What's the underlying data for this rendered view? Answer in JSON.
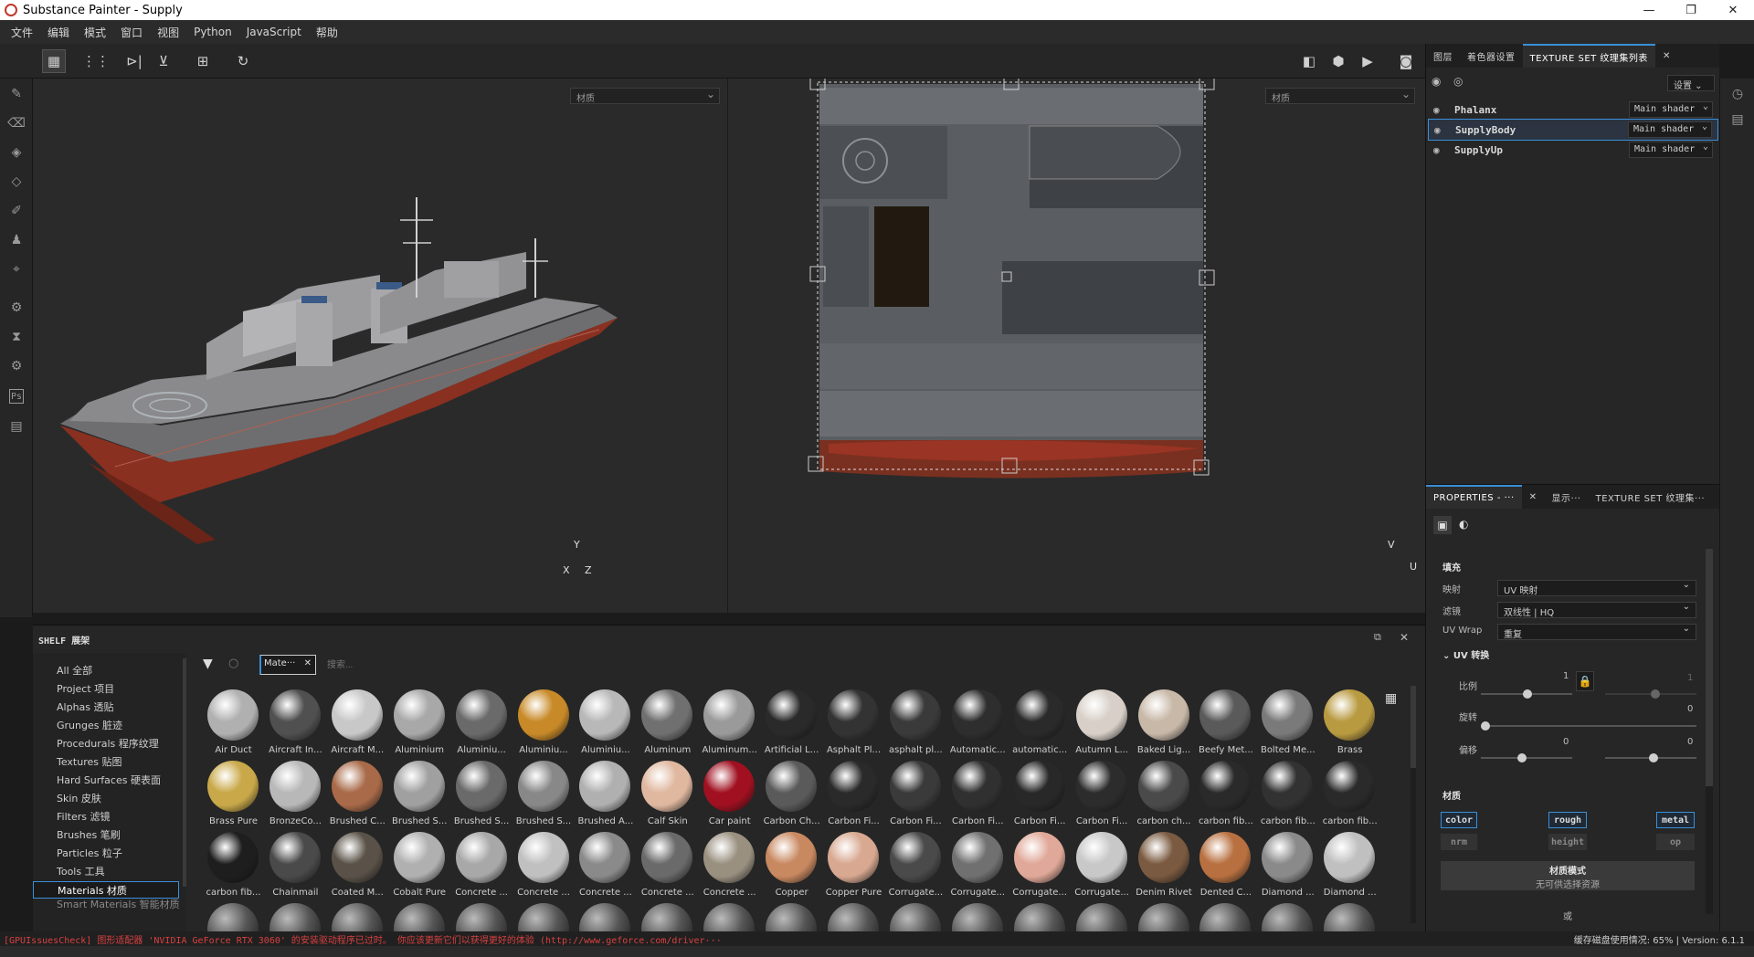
{
  "window": {
    "title": "Substance Painter - Supply",
    "controls": [
      "—",
      "❐",
      "✕"
    ]
  },
  "menu": [
    "文件",
    "编辑",
    "模式",
    "窗口",
    "视图",
    "Python",
    "JavaScript",
    "帮助"
  ],
  "viewports": {
    "left_material": "材质",
    "right_material": "材质",
    "axis3d": {
      "y": "Y",
      "x": "X",
      "z": "Z"
    },
    "axis2d": {
      "v": "V",
      "u": "U"
    }
  },
  "texture_set_panel": {
    "tabs": [
      "图层",
      "着色器设置",
      "TEXTURE SET 纹理集列表"
    ],
    "settings_label": "设置",
    "sets": [
      {
        "name": "Phalanx",
        "shader": "Main shader",
        "selected": false
      },
      {
        "name": "SupplyBody",
        "shader": "Main shader",
        "selected": true
      },
      {
        "name": "SupplyUp",
        "shader": "Main shader",
        "selected": false
      }
    ]
  },
  "properties": {
    "tabs": [
      "PROPERTIES - ···",
      "显示···",
      "TEXTURE SET 纹理集···"
    ],
    "fill_heading": "填充",
    "mapping_label": "映射",
    "mapping_value": "UV 映射",
    "filter_label": "滤镜",
    "filter_value": "双线性 | HQ",
    "uvwrap_label": "UV Wrap",
    "uvwrap_value": "重复",
    "uv_transform": "UV 转换",
    "scale_label": "比例",
    "scale_value": "1",
    "scale_value2": "1",
    "rotate_label": "旋转",
    "rotate_value": "0",
    "offset_label": "偏移",
    "offset_value1": "0",
    "offset_value2": "0",
    "material_heading": "材质",
    "channels_row1": [
      "color",
      "rough",
      "metal"
    ],
    "channels_row2": [
      "nrm",
      "height",
      "op"
    ],
    "mode_title": "材质模式",
    "mode_sub": "无可供选择资源",
    "or_label": "或"
  },
  "shelf": {
    "title": "SHELF 展架",
    "filter_chip": "Mate···",
    "search_placeholder": "搜索...",
    "categories": [
      "All 全部",
      "Project 项目",
      "Alphas 透贴",
      "Grunges 脏迹",
      "Procedurals 程序纹理",
      "Textures 贴图",
      "Hard Surfaces 硬表面",
      "Skin 皮肤",
      "Filters 滤镜",
      "Brushes 笔刷",
      "Particles 粒子",
      "Tools 工具",
      "Materials 材质",
      "Smart Materials 智能材质"
    ],
    "selected_category": "Materials 材质",
    "materials": [
      {
        "name": "Air Duct",
        "color": "#b0b0b0"
      },
      {
        "name": "Aircraft In...",
        "color": "#505050"
      },
      {
        "name": "Aircraft M...",
        "color": "#c8c8c8"
      },
      {
        "name": "Aluminium",
        "color": "#a8a8a8"
      },
      {
        "name": "Aluminiu...",
        "color": "#6a6a6a"
      },
      {
        "name": "Aluminiu...",
        "color": "#c88a28"
      },
      {
        "name": "Aluminiu...",
        "color": "#b8b8b8"
      },
      {
        "name": "Aluminum",
        "color": "#707070"
      },
      {
        "name": "Aluminum...",
        "color": "#9a9a9a"
      },
      {
        "name": "Artificial L...",
        "color": "#2a2a2a"
      },
      {
        "name": "Asphalt Pl...",
        "color": "#333333"
      },
      {
        "name": "asphalt pl...",
        "color": "#3a3a3a"
      },
      {
        "name": "Automatic...",
        "color": "#2e2e2e"
      },
      {
        "name": "automatic...",
        "color": "#2a2a2a"
      },
      {
        "name": "Autumn L...",
        "color": "#d8d0c8"
      },
      {
        "name": "Baked Lig...",
        "color": "#c8b8a8"
      },
      {
        "name": "Beefy Met...",
        "color": "#5a5a5a"
      },
      {
        "name": "Bolted Me...",
        "color": "#7a7a7a"
      },
      {
        "name": "Brass",
        "color": "#b89a40"
      },
      {
        "name": "Brass Pure",
        "color": "#c8a848"
      },
      {
        "name": "BronzeCo...",
        "color": "#b8b8b8"
      },
      {
        "name": "Brushed C...",
        "color": "#a86a48"
      },
      {
        "name": "Brushed S...",
        "color": "#a0a0a0"
      },
      {
        "name": "Brushed S...",
        "color": "#6a6a6a"
      },
      {
        "name": "Brushed S...",
        "color": "#888888"
      },
      {
        "name": "Brushed A...",
        "color": "#b0b0b0"
      },
      {
        "name": "Calf Skin",
        "color": "#e0b8a0"
      },
      {
        "name": "Car paint",
        "color": "#a01020"
      },
      {
        "name": "Carbon Ch...",
        "color": "#5a5a5a"
      },
      {
        "name": "Carbon Fi...",
        "color": "#2a2a2a"
      },
      {
        "name": "Carbon Fi...",
        "color": "#3a3a3a"
      },
      {
        "name": "Carbon Fi...",
        "color": "#303030"
      },
      {
        "name": "Carbon Fi...",
        "color": "#282828"
      },
      {
        "name": "Carbon Fi...",
        "color": "#2c2c2c"
      },
      {
        "name": "carbon ch...",
        "color": "#4a4a4a"
      },
      {
        "name": "carbon fib...",
        "color": "#2a2a2a"
      },
      {
        "name": "carbon fib...",
        "color": "#323232"
      },
      {
        "name": "carbon fib...",
        "color": "#2a2a2a"
      },
      {
        "name": "carbon fib...",
        "color": "#1e1e1e"
      },
      {
        "name": "Chainmail",
        "color": "#4a4a4a"
      },
      {
        "name": "Coated M...",
        "color": "#5a5248"
      },
      {
        "name": "Cobalt Pure",
        "color": "#b0b0b0"
      },
      {
        "name": "Concrete ...",
        "color": "#a8a8a8"
      },
      {
        "name": "Concrete ...",
        "color": "#c0c0c0"
      },
      {
        "name": "Concrete ...",
        "color": "#8a8a8a"
      },
      {
        "name": "Concrete ...",
        "color": "#6a6a6a"
      },
      {
        "name": "Concrete ...",
        "color": "#9a9080"
      },
      {
        "name": "Copper",
        "color": "#c88860"
      },
      {
        "name": "Copper Pure",
        "color": "#d8a890"
      },
      {
        "name": "Corrugate...",
        "color": "#4a4a4a"
      },
      {
        "name": "Corrugate...",
        "color": "#707070"
      },
      {
        "name": "Corrugate...",
        "color": "#e0a898"
      },
      {
        "name": "Corrugate...",
        "color": "#c8c8c8"
      },
      {
        "name": "Denim Rivet",
        "color": "#7a5a40"
      },
      {
        "name": "Dented C...",
        "color": "#b87040"
      },
      {
        "name": "Diamond ...",
        "color": "#8a8a8a"
      },
      {
        "name": "Diamond ...",
        "color": "#c0c0c0"
      }
    ]
  },
  "status": {
    "warning": "[GPUIssuesCheck] 图形适配器 'NVIDIA GeForce RTX 3060' 的安装驱动程序已过时。 你应该更新它们以获得更好的体验 (http://www.geforce.com/driver···",
    "right": "缓存磁盘使用情况: 65% | Version: 6.1.1"
  },
  "colors": {
    "accent": "#3a8fd8",
    "hull_red": "#9a3020",
    "warning": "#d94040"
  }
}
